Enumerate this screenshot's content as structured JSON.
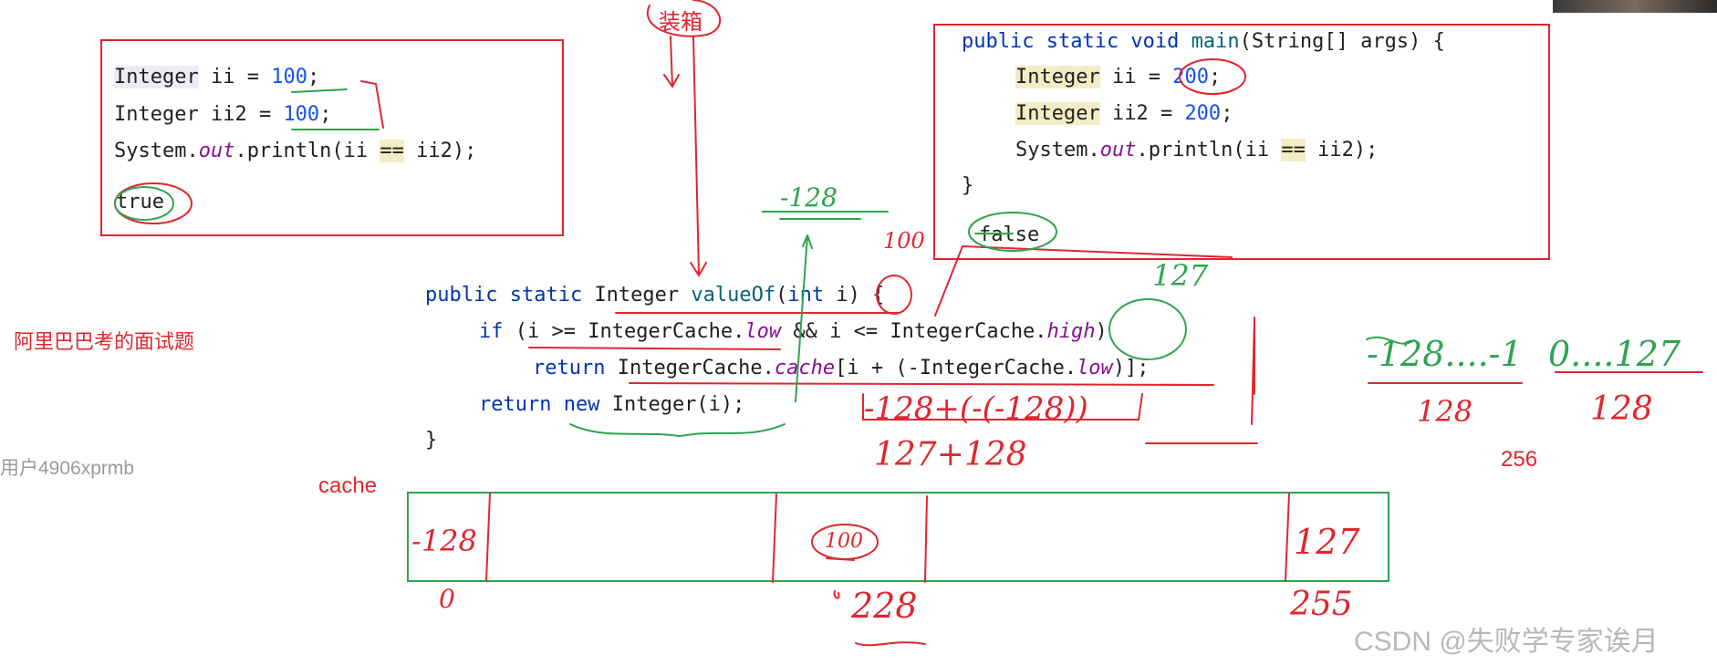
{
  "top_label": "装箱",
  "left_code": {
    "line1": {
      "type": "Integer",
      "rest": " ii = ",
      "num": "100",
      "end": ";"
    },
    "line2": {
      "type": "Integer",
      "rest": " ii2 = ",
      "num": "100",
      "end": ";"
    },
    "line3": {
      "pre": "System.",
      "field": "out",
      "mid": ".println(ii ",
      "op": "==",
      "post": " ii2);"
    },
    "output": "true"
  },
  "right_code": {
    "sig": {
      "kw": "public static void ",
      "method": "main",
      "rest": "(String[] args) {"
    },
    "line1": {
      "type": "Integer",
      "rest": " ii = ",
      "num": "200",
      "end": ";"
    },
    "line2": {
      "type": "Integer",
      "rest": " ii2 = ",
      "num": "200",
      "end": ";"
    },
    "line3": {
      "pre": "System.",
      "field": "out",
      "mid": ".println(ii ",
      "op": "==",
      "post": " ii2);"
    },
    "close": "}",
    "output": "false"
  },
  "valueof_code": {
    "l1": {
      "kw": "public static ",
      "type": "Integer ",
      "method": "valueOf",
      "open": "(",
      "kw2": "int",
      "rest": " i) {"
    },
    "l2": {
      "kw": "if",
      "a": " (i >= IntegerCache.",
      "f1": "low",
      "b": " && i <= IntegerCache.",
      "f2": "high",
      "c": ")"
    },
    "l3": {
      "kw": "return",
      "a": " IntegerCache.",
      "f1": "cache",
      "b": "[i + (-IntegerCache.",
      "f2": "low",
      "c": ")];"
    },
    "l4": {
      "kw": "return",
      "kw2": " new",
      "rest": " Integer(i);"
    },
    "l5": "}"
  },
  "side_label": "阿里巴巴考的面试题",
  "watermark_user": "用户4906xprmb",
  "cache_label": "cache",
  "count_label": "256",
  "annotations": {
    "neg128_top": "-128",
    "num100_small": "100",
    "num127_high": "127",
    "expr1": "-128+(-(-128))",
    "expr2": "127+128",
    "range_left": "-128....-1",
    "range_right": "0....127",
    "count_left": "128",
    "count_right": "128",
    "cache_first": "-128",
    "cache_mid": "100",
    "cache_last": "127",
    "idx_first": "0",
    "idx_mid": "228",
    "idx_last": "255"
  },
  "csdn_watermark": "CSDN @失败学专家诶月"
}
